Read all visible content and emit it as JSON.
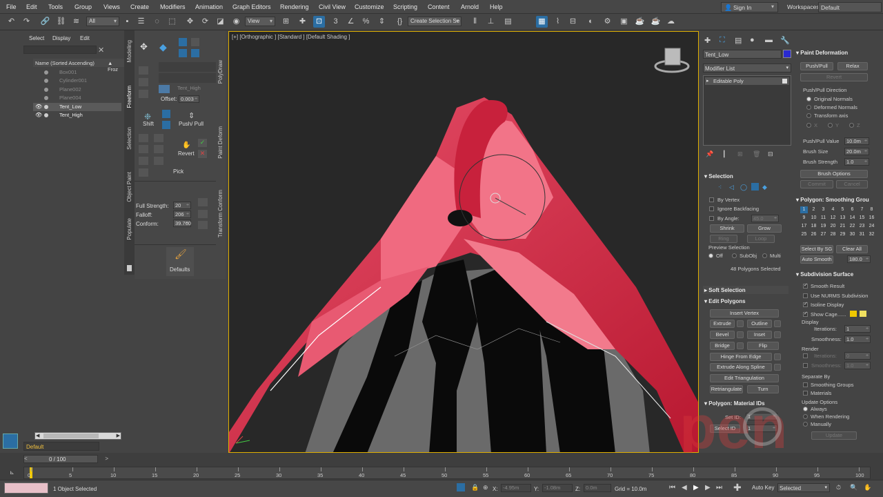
{
  "menubar": {
    "items": [
      "File",
      "Edit",
      "Tools",
      "Group",
      "Views",
      "Create",
      "Modifiers",
      "Animation",
      "Graph Editors",
      "Rendering",
      "Civil View",
      "Customize",
      "Scripting",
      "Content",
      "Arnold",
      "Help"
    ],
    "sign_in": "Sign In",
    "workspaces_label": "Workspaces:",
    "workspaces_value": "Default"
  },
  "toolbar": {
    "selection_filter": "All",
    "ref_coord": "View",
    "named_selection": "Create Selection Se"
  },
  "scene_explorer": {
    "tabs": [
      "Select",
      "Display",
      "Edit"
    ],
    "column_header": "Name (Sorted Ascending)",
    "column_header2": "▲ Froz",
    "items": [
      {
        "name": "Box001",
        "visible": false
      },
      {
        "name": "Cylinder001",
        "visible": false
      },
      {
        "name": "Plane002",
        "visible": false
      },
      {
        "name": "Plane004",
        "visible": false
      },
      {
        "name": "Tent_Low",
        "visible": true
      },
      {
        "name": "Tent_High",
        "visible": true
      }
    ],
    "layer": "Default"
  },
  "ribbon": {
    "tabs": [
      "Modeling",
      "Freeform",
      "Selection",
      "Object Paint",
      "Populate"
    ],
    "right_tabs": [
      "PolyDraw",
      "Paint Deform",
      "Transform Conform"
    ],
    "offset_label": "Offset:",
    "offset_value": "0.003",
    "target_name": "Tent_High",
    "shift_label": "Shift",
    "pushpull_label": "Push/ Pull",
    "revert_label": "Revert",
    "pick_label": "Pick",
    "full_strength_label": "Full Strength:",
    "full_strength_value": "20",
    "falloff_label": "Falloff:",
    "falloff_value": "206",
    "conform_label": "Conform:",
    "conform_value": "39.760",
    "defaults_label": "Defaults"
  },
  "viewport": {
    "label": "[+] [Orthographic ] [Standard ] [Default Shading ]"
  },
  "command_panel": {
    "object_name": "Tent_Low",
    "object_color": "#2a2ad0",
    "modifier_list": "Modifier List",
    "stack_item": "Editable Poly",
    "selection": {
      "header": "Selection",
      "by_vertex": "By Vertex",
      "ignore_backfacing": "Ignore Backfacing",
      "by_angle": "By Angle:",
      "by_angle_value": "45.0",
      "shrink": "Shrink",
      "grow": "Grow",
      "ring": "Ring",
      "loop": "Loop",
      "preview_selection": "Preview Selection",
      "preview_options": [
        "Off",
        "SubObj",
        "Multi"
      ],
      "status": "48 Polygons Selected"
    },
    "soft_selection": "Soft Selection",
    "edit_polygons": {
      "header": "Edit Polygons",
      "insert_vertex": "Insert Vertex",
      "extrude": "Extrude",
      "outline": "Outline",
      "bevel": "Bevel",
      "inset": "Inset",
      "bridge": "Bridge",
      "flip": "Flip",
      "hinge": "Hinge From Edge",
      "extrude_spline": "Extrude Along Spline",
      "edit_tri": "Edit Triangulation",
      "retriangulate": "Retriangulate",
      "turn": "Turn"
    },
    "material_ids": {
      "header": "Polygon: Material IDs",
      "set_id": "Set ID:",
      "set_id_value": "1",
      "select_id": "Select ID",
      "select_id_value": "1"
    }
  },
  "paint_deformation": {
    "header": "Paint Deformation",
    "pushpull": "Push/Pull",
    "relax": "Relax",
    "revert": "Revert",
    "direction_label": "Push/Pull Direction",
    "directions": [
      "Original Normals",
      "Deformed Normals",
      "Transform axis"
    ],
    "axes": [
      "X",
      "Y",
      "Z"
    ],
    "pushpull_value_label": "Push/Pull Value",
    "pushpull_value": "10.0m",
    "brush_size_label": "Brush Size",
    "brush_size": "20.0m",
    "brush_strength_label": "Brush Strength",
    "brush_strength": "1.0",
    "brush_options": "Brush Options",
    "commit": "Commit",
    "cancel": "Cancel"
  },
  "smoothing": {
    "header": "Polygon: Smoothing Grou",
    "groups": [
      "1",
      "2",
      "3",
      "4",
      "5",
      "6",
      "7",
      "8",
      "9",
      "10",
      "11",
      "12",
      "13",
      "14",
      "15",
      "16",
      "17",
      "18",
      "19",
      "20",
      "21",
      "22",
      "23",
      "24",
      "25",
      "26",
      "27",
      "28",
      "29",
      "30",
      "31",
      "32"
    ],
    "select_by_sg": "Select By SG",
    "clear_all": "Clear All",
    "auto_smooth": "Auto Smooth",
    "auto_smooth_value": "180.0"
  },
  "subdivision": {
    "header": "Subdivision Surface",
    "smooth_result": "Smooth Result",
    "use_nurms": "Use NURMS Subdivision",
    "isoline": "Isoline Display",
    "show_cage": "Show Cage......",
    "cage_colors": [
      "#f0c800",
      "#f0e060"
    ],
    "display_label": "Display",
    "iterations_label": "Iterations:",
    "iterations_display": "1",
    "smoothness_label": "Smoothness:",
    "smoothness_display": "1.0",
    "render_label": "Render",
    "iterations_render": "0",
    "smoothness_render": "1.0",
    "separate_by": "Separate By",
    "smoothing_groups": "Smoothing Groups",
    "materials": "Materials",
    "update_options": "Update Options",
    "update_modes": [
      "Always",
      "When Rendering",
      "Manually"
    ],
    "update_btn": "Update"
  },
  "timeline": {
    "frame_display": "0 / 100",
    "ticks": [
      "0",
      "5",
      "10",
      "15",
      "20",
      "25",
      "30",
      "35",
      "40",
      "45",
      "50",
      "55",
      "60",
      "65",
      "70",
      "75",
      "80",
      "85",
      "90",
      "95",
      "100"
    ]
  },
  "statusbar": {
    "selected": "1 Object Selected",
    "x_label": "X:",
    "x_value": "-4.95m",
    "y_label": "Y:",
    "y_value": "-1.08m",
    "z_label": "Z:",
    "z_value": "0.0m",
    "grid": "Grid = 10.0m",
    "auto_key": "Auto Key",
    "key_mode": "Selected"
  },
  "watermark": "pen"
}
